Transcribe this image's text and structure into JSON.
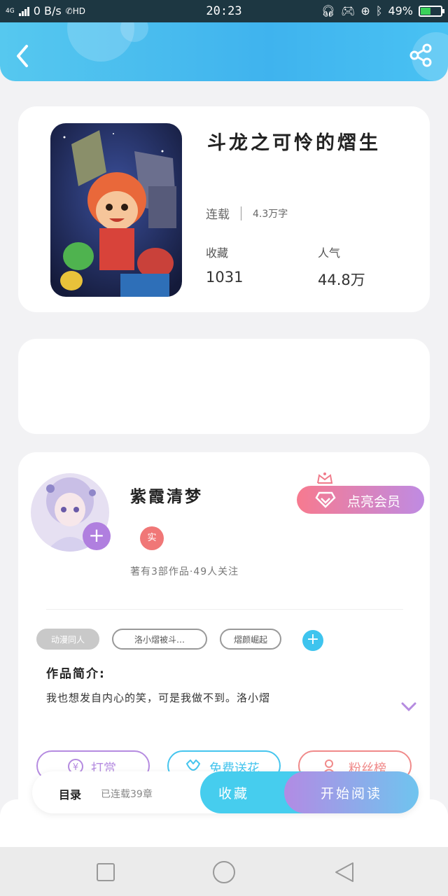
{
  "status_bar": {
    "network": "4G",
    "speed": "0 B/s",
    "hd": "HD",
    "time": "20:23",
    "battery": "49%",
    "battery_level": 0.49
  },
  "header": {
    "back_icon": "chevron-left-icon",
    "share_icon": "share-icon"
  },
  "book": {
    "title": "斗龙之可怜的熠生",
    "status": "连载",
    "word_count": "4.3万字",
    "favorites_label": "收藏",
    "favorites_value": "1031",
    "popularity_label": "人气",
    "popularity_value": "44.8万"
  },
  "author": {
    "name": "紫霞清梦",
    "badge": "实",
    "meta": "著有3部作品·49人关注",
    "vip_button": "点亮会员",
    "tags": [
      "动漫同人",
      "洛小熠被斗…",
      "熠颜崛起"
    ],
    "intro_title": "作品简介:",
    "intro_text": "我也想发自内心的笑，可是我做不到。洛小熠",
    "actions": [
      {
        "label": "打赏",
        "icon": "yen-coin-icon",
        "color": "#b58be0"
      },
      {
        "label": "免费送花",
        "icon": "flower-icon",
        "color": "#46c5ee"
      },
      {
        "label": "粉丝榜",
        "icon": "user-icon",
        "color": "#f08a8a"
      }
    ]
  },
  "bottom_bar": {
    "toc": "目录",
    "toc_sub": "已连载39章",
    "collect": "收藏",
    "read": "开始阅读"
  },
  "nav": {
    "recent": "square-icon",
    "home": "circle-icon",
    "back": "triangle-back-icon"
  }
}
